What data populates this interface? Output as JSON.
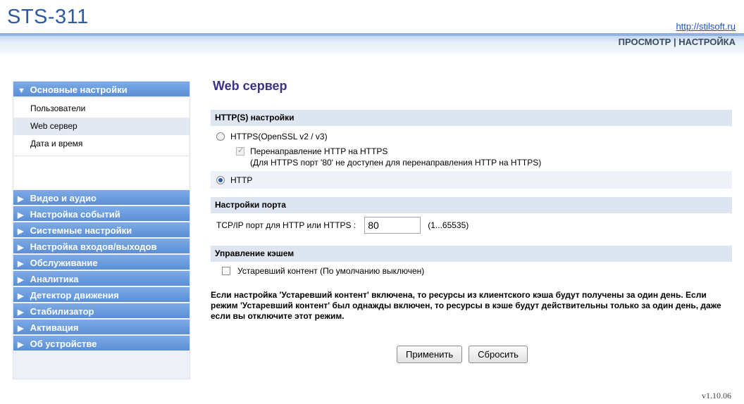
{
  "header": {
    "app_title": "STS-311",
    "site_link": "http://stilsoft.ru",
    "nav_view": "ПРОСМОТР",
    "nav_separator": "|",
    "nav_settings": "НАСТРОЙКА"
  },
  "sidebar": {
    "main_section": {
      "label": "Основные настройки",
      "expanded": true,
      "items": [
        {
          "label": "Пользователи",
          "active": false
        },
        {
          "label": "Web сервер",
          "active": true
        },
        {
          "label": "Дата и время",
          "active": false
        }
      ]
    },
    "sections": [
      {
        "label": "Видео и аудио"
      },
      {
        "label": "Настройка событий"
      },
      {
        "label": "Системные настройки"
      },
      {
        "label": "Настройка входов/выходов"
      },
      {
        "label": "Обслуживание"
      },
      {
        "label": "Аналитика"
      },
      {
        "label": "Детектор движения"
      },
      {
        "label": "Стабилизатор"
      },
      {
        "label": "Активация"
      },
      {
        "label": "Об устройстве"
      }
    ]
  },
  "main": {
    "title": "Web сервер",
    "https_group": {
      "header": "HTTP(S) настройки",
      "https_label": "HTTPS(OpenSSL v2 / v3)",
      "https_selected": false,
      "redirect_label": "Перенаправление HTTP на HTTPS",
      "redirect_checked": true,
      "redirect_disabled": true,
      "redirect_note": "(Для HTTPS порт '80' не доступен для перенаправления HTTP на HTTPS)",
      "http_label": "HTTP",
      "http_selected": true
    },
    "port_group": {
      "header": "Настройки порта",
      "label": "TCP/IP порт для HTTP или HTTPS :",
      "value": "80",
      "range": "(1...65535)"
    },
    "cache_group": {
      "header": "Управление кэшем",
      "stale_label": "Устаревший контент (По умолчанию выключен)",
      "stale_checked": false,
      "description": "Если настройка 'Устаревший контент' включена, то ресурсы из клиентского кэша будут получены за один день. Если режим 'Устаревший контент' был однажды включен, то ресурсы в кэше будут действительны только за один день, даже если вы отключите этот режим."
    },
    "buttons": {
      "apply": "Применить",
      "reset": "Сбросить"
    }
  },
  "footer": {
    "version": "v1.10.06"
  },
  "colors": {
    "brand_blue": "#2d5aa0",
    "sidebar_header": "#6a9be0",
    "page_title": "#3a3288",
    "group_header_bg": "#dde5f0"
  }
}
